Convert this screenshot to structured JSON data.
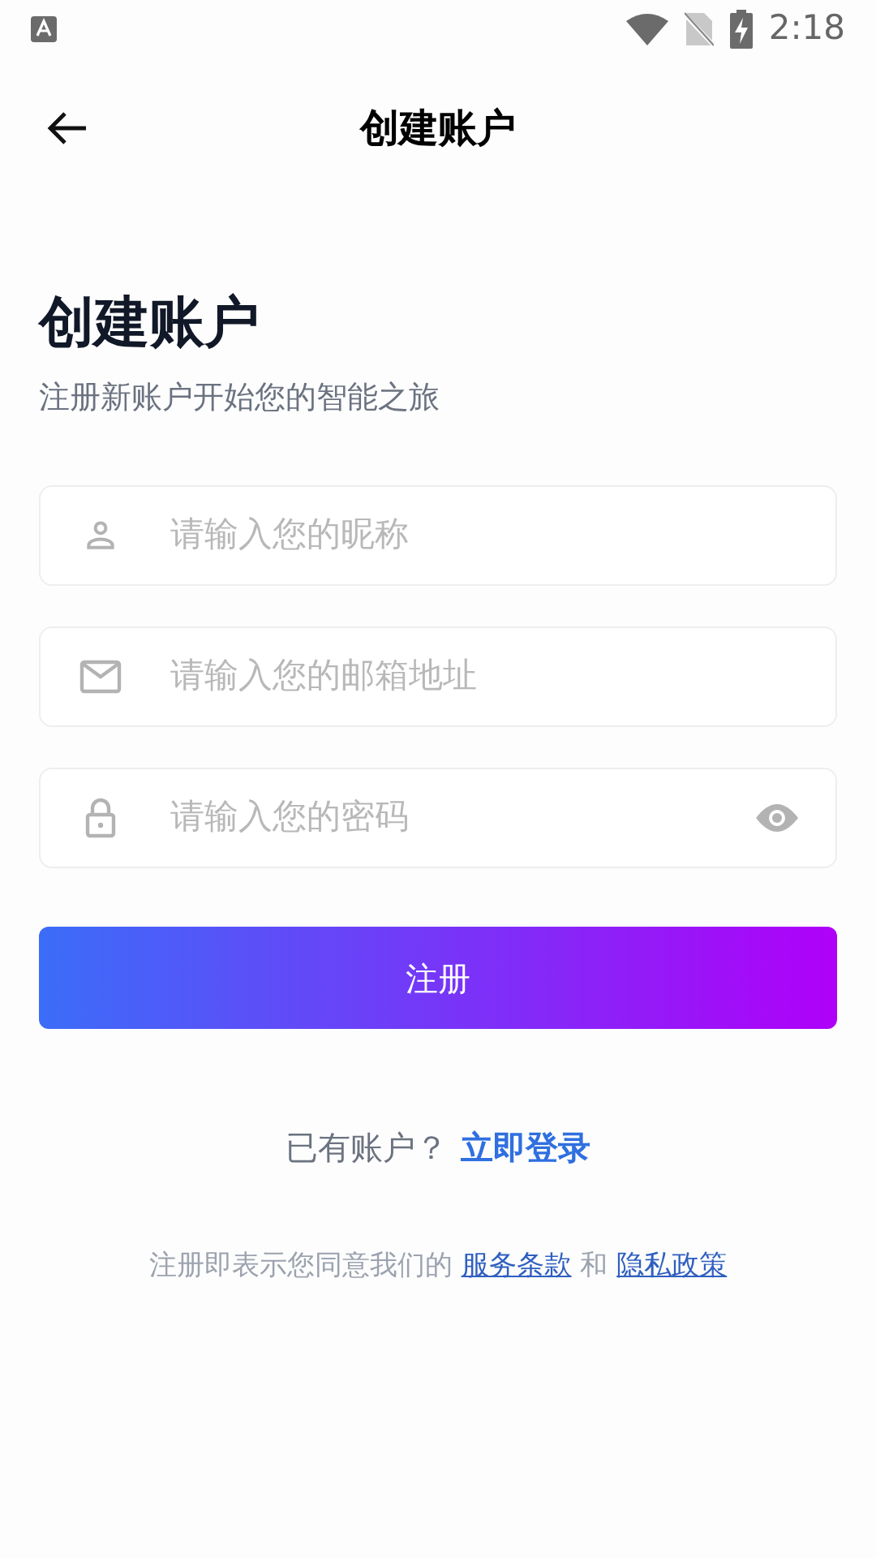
{
  "status_bar": {
    "time": "2:18"
  },
  "app_bar": {
    "title": "创建账户"
  },
  "heading": {
    "title": "创建账户",
    "subtitle": "注册新账户开始您的智能之旅"
  },
  "fields": [
    {
      "kind": "user",
      "placeholder": "请输入您的昵称",
      "visibility_toggle": false
    },
    {
      "kind": "mail",
      "placeholder": "请输入您的邮箱地址",
      "visibility_toggle": false
    },
    {
      "kind": "lock",
      "placeholder": "请输入您的密码",
      "visibility_toggle": true
    }
  ],
  "submit_button": "注册",
  "login_prompt": {
    "text": "已有账户？",
    "link": "立即登录"
  },
  "terms": {
    "prefix": "注册即表示您同意我们的",
    "link_1": "服务条款",
    "conjunction": "和",
    "link_2": "隐私政策"
  }
}
